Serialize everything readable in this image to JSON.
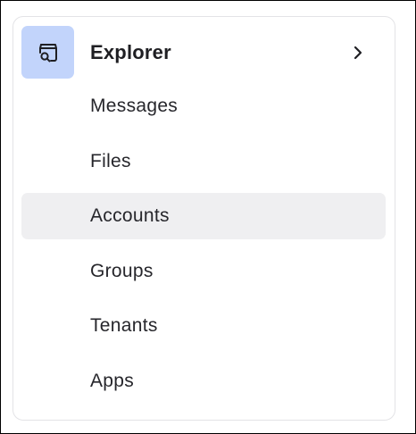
{
  "explorer": {
    "title": "Explorer",
    "icon": "explorer-search-icon",
    "expand_icon": "chevron-right-icon",
    "accent_color": "#c2d4fb"
  },
  "nav": {
    "items": [
      {
        "label": "Messages",
        "selected": false
      },
      {
        "label": "Files",
        "selected": false
      },
      {
        "label": "Accounts",
        "selected": true
      },
      {
        "label": "Groups",
        "selected": false
      },
      {
        "label": "Tenants",
        "selected": false
      },
      {
        "label": "Apps",
        "selected": false
      }
    ],
    "selected_background": "#efeff1"
  }
}
